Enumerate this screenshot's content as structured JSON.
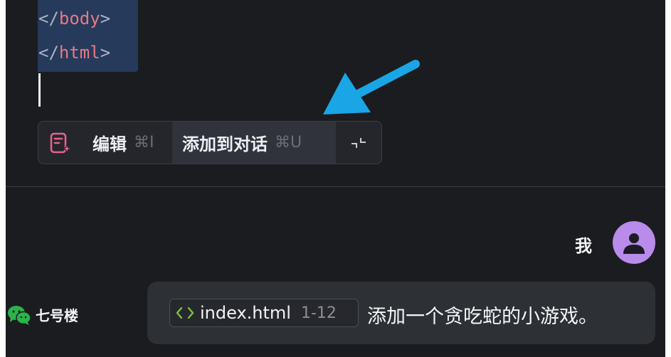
{
  "editor": {
    "code_lines": [
      {
        "open": "</",
        "tag": "body",
        "close": ">"
      },
      {
        "open": "</",
        "tag": "html",
        "close": ">"
      }
    ]
  },
  "toolbar": {
    "edit_label": "编辑",
    "edit_shortcut": "⌘I",
    "add_label": "添加到对话",
    "add_shortcut": "⌘U",
    "icons": {
      "edit": "edit-sparkle-icon",
      "collapse": "collapse-icon"
    }
  },
  "annotation": {
    "arrow_color": "#1aa6e6"
  },
  "chat": {
    "user_label": "我",
    "contact_name": "七号楼",
    "contact_icon": "wechat-icon",
    "message": {
      "file_name": "index.html",
      "file_range": "1-12",
      "text": "添加一个贪吃蛇的小游戏。"
    }
  },
  "colors": {
    "background": "#1b1c20",
    "selection": "#263a5c",
    "tag": "#e47a84",
    "avatar": "#b98bea",
    "edit_icon": "#e2648b",
    "code_icon": "#7ac142"
  }
}
